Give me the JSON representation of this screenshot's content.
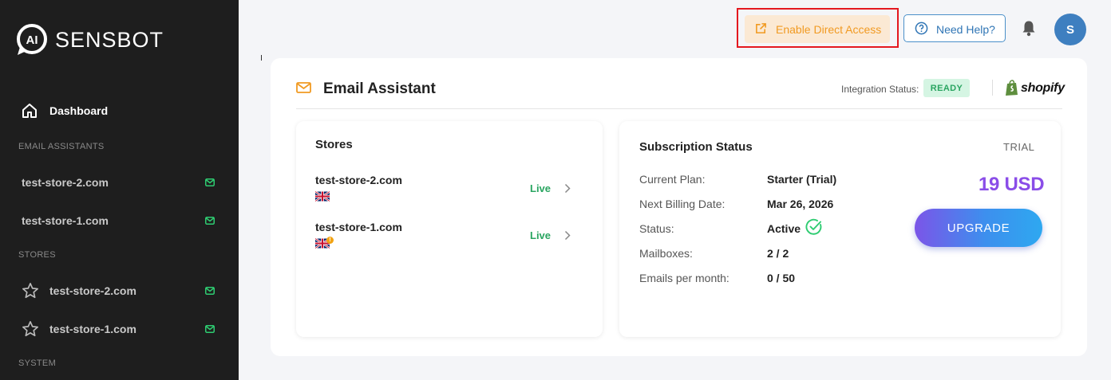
{
  "sidebar": {
    "brand": "SENSBOT",
    "brand_badge": "AI",
    "dashboard_label": "Dashboard",
    "section_email": "EMAIL ASSISTANTS",
    "email_items": [
      "test-store-2.com",
      "test-store-1.com"
    ],
    "section_stores": "STORES",
    "store_items": [
      "test-store-2.com",
      "test-store-1.com"
    ],
    "section_system": "SYSTEM"
  },
  "header": {
    "direct_access_label": "Enable Direct Access",
    "help_label": "Need Help?",
    "avatar_initial": "S"
  },
  "card": {
    "title": "Email Assistant",
    "integration_label": "Integration Status:",
    "integration_status": "READY",
    "platform": "shopify"
  },
  "stores_panel": {
    "title": "Stores",
    "rows": [
      {
        "name": "test-store-2.com",
        "status": "Live",
        "warning": false
      },
      {
        "name": "test-store-1.com",
        "status": "Live",
        "warning": true
      }
    ]
  },
  "subscription": {
    "title": "Subscription Status",
    "tier": "TRIAL",
    "rows": [
      {
        "label": "Current Plan:",
        "value": "Starter (Trial)"
      },
      {
        "label": "Next Billing Date:",
        "value": "Mar 26, 2026"
      },
      {
        "label": "Status:",
        "value": "Active"
      },
      {
        "label": "Mailboxes:",
        "value": "2 / 2"
      },
      {
        "label": "Emails per month:",
        "value": "0 / 50"
      }
    ],
    "price": "19 USD",
    "upgrade_label": "UPGRADE"
  },
  "colors": {
    "accent_orange": "#f19a22",
    "live_green": "#2aa561",
    "price_purple": "#8a4de8",
    "highlight_red": "#e4181f"
  }
}
